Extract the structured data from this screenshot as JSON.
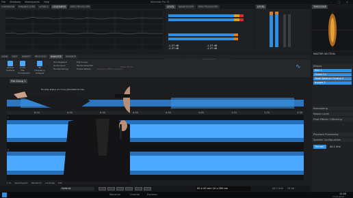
{
  "title_bar": {
    "app": "Wavelab Pro 11",
    "doc": "- [Почему водка на столе] .wav [9.0 material/ Grigory Leps] Соmpressed! Piano] - Почему водка на столе]",
    "win_controls": [
      "–",
      "□",
      "×"
    ]
  },
  "menu": [
    "File",
    "Windows",
    "Workspaces",
    "Help"
  ],
  "top_tabs_left": [
    "OVERVIEW",
    "PHASESCOPE",
    "LEVELS",
    "LOUDNESS",
    "SPECTROSCOPE"
  ],
  "top_tabs_mid": [
    "LEVEL",
    "WAVESCOPE",
    "SPECTROSCOPE"
  ],
  "top_tabs_right": [
    "LEVEL",
    "TIMECODE"
  ],
  "meter_readings": {
    "left_top": "-1.27 dB",
    "right_top": "-1.27 dB",
    "row2_left": "-1.27 dB",
    "row2_right": "-1.27 dB"
  },
  "meter_scale": [
    "-40",
    "-30",
    "-24",
    "-18",
    "-15",
    "-12",
    "-9",
    "-6",
    "-3",
    "0"
  ],
  "level_scale": [
    "-6",
    "-4",
    "-2",
    "0"
  ],
  "lower_tabs": [
    "CORRECTION",
    "SPECTRUM",
    "ANALYSIS",
    "RENDER"
  ],
  "process_tabs": [
    "VIEW",
    "EDIT",
    "INSERT",
    "PROCESS",
    "ANALYZE",
    "RENDER"
  ],
  "toolbar_groups": [
    {
      "label": "Global Analysis",
      "icon": "waveform-icon"
    },
    {
      "label": "Audio File Comparator",
      "icon": "compare-icon"
    },
    {
      "label": "3D Frequency Analysis",
      "icon": "chart-icon"
    }
  ],
  "toolbar_options": [
    "Hot Playback",
    "Audio Input",
    "Fire Rendering",
    "Edit Cursor",
    "Studio Selection",
    "Freeze Meters",
    "Dynamic Offline Analysis",
    "Meter Mode",
    "Waveform"
  ],
  "file_tab": "File Group 1",
  "file_name": "Почему водка на столе_Remastered.wav",
  "tracks": [
    {
      "name": "L"
    },
    {
      "name": "R"
    }
  ],
  "time_ruler": [
    "0:10",
    "0:20",
    "0:30",
    "0:40",
    "0:50",
    "1:00",
    "1:10",
    "1:20",
    "1:30"
  ],
  "status_left": [
    "1 ch",
    "Spectrogram",
    "Waveform",
    "Loudness",
    "Info"
  ],
  "transport": {
    "preset": "Default",
    "time": "00 h 00 min 10 s 000 ms",
    "sample_rate": "44.1 kHz",
    "bits": "24 bit"
  },
  "right_panel": {
    "title": "MASTER SECTION",
    "sections": [
      "Effects",
      "Resampling",
      "Master Level",
      "Final Effects / Dithering",
      "Playback Processing",
      "Speaker Configuration"
    ],
    "plugins": [
      "Slot 1",
      "Ozone 11",
      "Tonal Balance Control 2",
      "Insight 2"
    ],
    "render_label": "Render",
    "level_value": "44.1 kHz"
  },
  "taskbar": {
    "time": "15:06",
    "date": "14.01.2024",
    "items": [
      "WaveLab",
      "Chrome",
      "Explorer",
      "Folder"
    ]
  },
  "colors": {
    "accent": "#2f8fe0",
    "wave": "#3fa3ff",
    "bg": "#1c1d1f",
    "panel": "#26282b",
    "meter_orange": "#e07a1e",
    "meter_red": "#d03030"
  }
}
